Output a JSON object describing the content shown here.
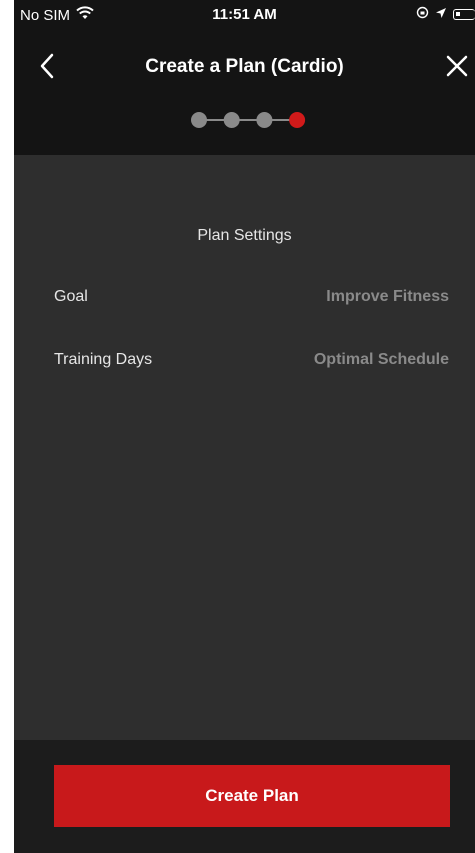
{
  "status_bar": {
    "carrier": "No SIM",
    "time": "11:51 AM"
  },
  "header": {
    "title": "Create a Plan (Cardio)",
    "back_icon": "chevron-left-icon",
    "close_icon": "close-icon"
  },
  "stepper": {
    "total_steps": 4,
    "current_step": 4,
    "inactive_color": "#8a8a8a",
    "active_color": "#d11a1a"
  },
  "plan_settings": {
    "section_title": "Plan Settings",
    "rows": [
      {
        "label": "Goal",
        "value": "Improve Fitness"
      },
      {
        "label": "Training Days",
        "value": "Optimal Schedule"
      }
    ]
  },
  "footer": {
    "create_button_label": "Create Plan",
    "button_color": "#c8191b"
  }
}
